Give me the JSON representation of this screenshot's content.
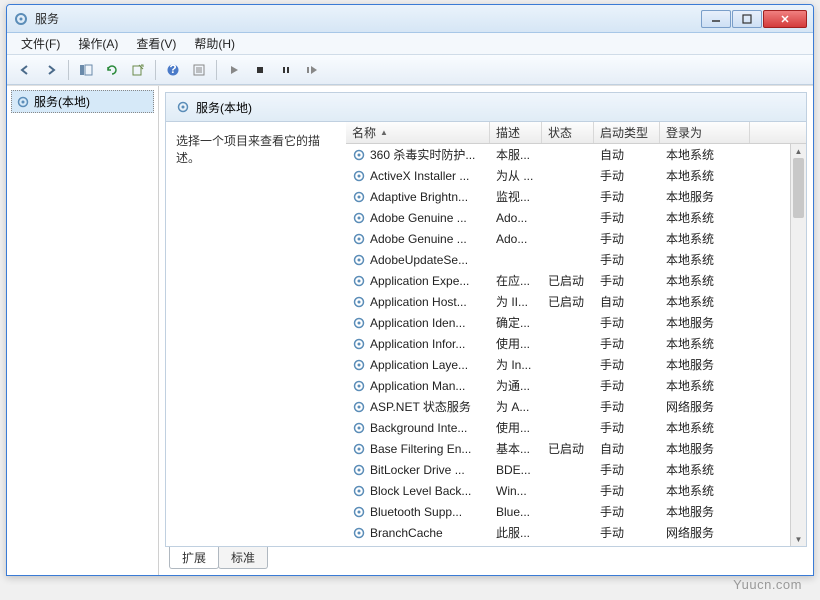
{
  "window": {
    "title": "服务"
  },
  "menu": {
    "file": "文件(F)",
    "action": "操作(A)",
    "view": "查看(V)",
    "help": "帮助(H)"
  },
  "tree": {
    "root": "服务(本地)"
  },
  "header": {
    "title": "服务(本地)"
  },
  "leftpane": {
    "prompt": "选择一个项目来查看它的描述。"
  },
  "columns": {
    "name": "名称",
    "desc": "描述",
    "status": "状态",
    "startup": "启动类型",
    "logon": "登录为"
  },
  "tabs": {
    "extended": "扩展",
    "standard": "标准"
  },
  "watermark": "Yuucn.com",
  "services": [
    {
      "name": "360 杀毒实时防护...",
      "desc": "本服...",
      "status": "",
      "startup": "自动",
      "logon": "本地系统"
    },
    {
      "name": "ActiveX Installer ...",
      "desc": "为从 ...",
      "status": "",
      "startup": "手动",
      "logon": "本地系统"
    },
    {
      "name": "Adaptive Brightn...",
      "desc": "监视...",
      "status": "",
      "startup": "手动",
      "logon": "本地服务"
    },
    {
      "name": "Adobe Genuine ...",
      "desc": "Ado...",
      "status": "",
      "startup": "手动",
      "logon": "本地系统"
    },
    {
      "name": "Adobe Genuine ...",
      "desc": "Ado...",
      "status": "",
      "startup": "手动",
      "logon": "本地系统"
    },
    {
      "name": "AdobeUpdateSe...",
      "desc": "",
      "status": "",
      "startup": "手动",
      "logon": "本地系统"
    },
    {
      "name": "Application Expe...",
      "desc": "在应...",
      "status": "已启动",
      "startup": "手动",
      "logon": "本地系统"
    },
    {
      "name": "Application Host...",
      "desc": "为 II...",
      "status": "已启动",
      "startup": "自动",
      "logon": "本地系统"
    },
    {
      "name": "Application Iden...",
      "desc": "确定...",
      "status": "",
      "startup": "手动",
      "logon": "本地服务"
    },
    {
      "name": "Application Infor...",
      "desc": "使用...",
      "status": "",
      "startup": "手动",
      "logon": "本地系统"
    },
    {
      "name": "Application Laye...",
      "desc": "为 In...",
      "status": "",
      "startup": "手动",
      "logon": "本地服务"
    },
    {
      "name": "Application Man...",
      "desc": "为通...",
      "status": "",
      "startup": "手动",
      "logon": "本地系统"
    },
    {
      "name": "ASP.NET 状态服务",
      "desc": "为 A...",
      "status": "",
      "startup": "手动",
      "logon": "网络服务"
    },
    {
      "name": "Background Inte...",
      "desc": "使用...",
      "status": "",
      "startup": "手动",
      "logon": "本地系统"
    },
    {
      "name": "Base Filtering En...",
      "desc": "基本...",
      "status": "已启动",
      "startup": "自动",
      "logon": "本地服务"
    },
    {
      "name": "BitLocker Drive ...",
      "desc": "BDE...",
      "status": "",
      "startup": "手动",
      "logon": "本地系统"
    },
    {
      "name": "Block Level Back...",
      "desc": "Win...",
      "status": "",
      "startup": "手动",
      "logon": "本地系统"
    },
    {
      "name": "Bluetooth Supp...",
      "desc": "Blue...",
      "status": "",
      "startup": "手动",
      "logon": "本地服务"
    },
    {
      "name": "BranchCache",
      "desc": "此服...",
      "status": "",
      "startup": "手动",
      "logon": "网络服务"
    }
  ]
}
